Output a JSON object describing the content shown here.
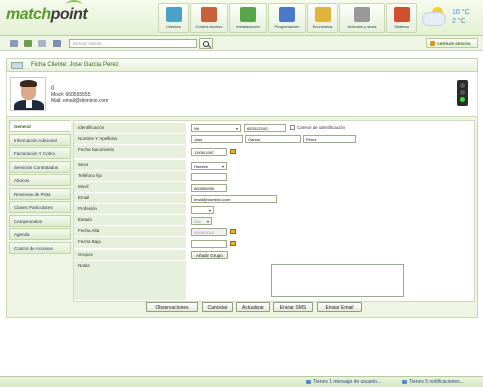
{
  "app": {
    "logo_part1": "match",
    "logo_part2": "point"
  },
  "modules": [
    {
      "label": "Clientes",
      "icon": "clients-icon",
      "color": "#4aa3c7"
    },
    {
      "label": "Control Acceso",
      "icon": "access-control-icon",
      "color": "#c6613a"
    },
    {
      "label": "Instalaciones",
      "icon": "facilities-icon",
      "color": "#57a64a"
    },
    {
      "label": "Programación",
      "icon": "schedule-icon",
      "color": "#4b79c9"
    },
    {
      "label": "Económica",
      "icon": "finance-icon",
      "color": "#e0b43a"
    },
    {
      "label": "Artículos y stock",
      "icon": "stock-icon",
      "color": "#999999"
    },
    {
      "label": "Sistema",
      "icon": "system-icon",
      "color": "#d0502d"
    }
  ],
  "weather": {
    "temp_high": "10 °C",
    "temp_low": "2 °C"
  },
  "toolbar": {
    "search_placeholder": "Buscar cliente...",
    "logout_label": "CERRAR SESIÓN"
  },
  "ficha": {
    "title": "Ficha Cliente: Jose Garcia Perez"
  },
  "client": {
    "number": "0",
    "mobile_line": "Movil: 660555555",
    "mail_line": "Mail: email@dominio.com"
  },
  "sidebar": {
    "items": [
      {
        "label": "General",
        "active": true
      },
      {
        "label": "Información Adicional"
      },
      {
        "label": "Facturación Y Cobro"
      },
      {
        "label": "Servicios Contratados"
      },
      {
        "label": "Abonos"
      },
      {
        "label": "Reservas de Pista"
      },
      {
        "label": "Clases Particulares"
      },
      {
        "label": "Campeonatos"
      },
      {
        "label": "Agenda"
      },
      {
        "label": "Control de Accesos"
      }
    ]
  },
  "form": {
    "labels": {
      "id": "Identificación",
      "name": "Nombre Y Apellidos",
      "birth": "Fecha Nacimiento",
      "sex": "Sexo",
      "phone": "Teléfono fijo",
      "mobile": "Movil",
      "email": "Email",
      "profession": "Profesión",
      "state": "Estado",
      "alta": "Fecha Alta",
      "baja": "Fecha Baja",
      "groups": "Grupos",
      "notes": "Notas"
    },
    "values": {
      "id_type": "Nif",
      "id_number": "65331234G",
      "no_id_label": "Carece de identificación",
      "first_name": "Jose",
      "last_name1": "Garcia",
      "last_name2": "Perez",
      "birth": "13/06/1987",
      "sex": "Hombre",
      "phone": "",
      "mobile": "660555555",
      "email": "email@dominio.com",
      "profession": "",
      "state": "Alta",
      "alta": "06/08/2010",
      "baja": "",
      "add_group_label": "Añadir Grupo"
    }
  },
  "actions": {
    "observaciones": "Observaciones",
    "cancelar": "Cancelar",
    "actualizar": "Actualizar",
    "enviar_sms": "Enviar SMS",
    "enviar_email": "Enviar Email"
  },
  "footer": {
    "messages": "Tienes 1 mensaje de usuario...",
    "notifications": "Tienes 5 notificaciones..."
  }
}
